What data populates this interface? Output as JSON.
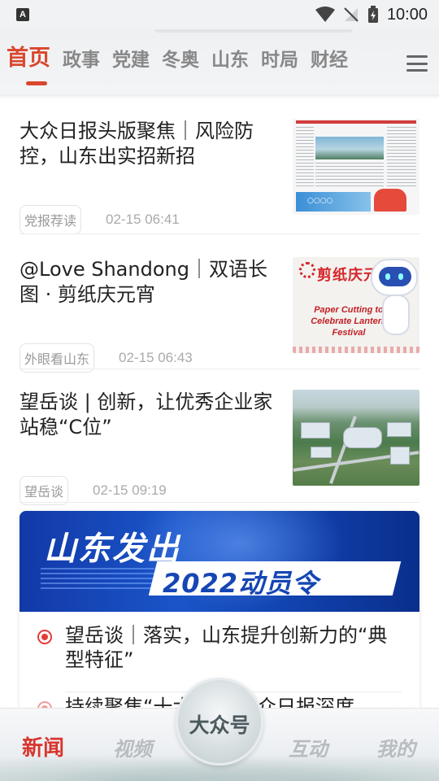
{
  "status_bar": {
    "time": "10:00",
    "left_icon": "A"
  },
  "top_tabs": [
    "首页",
    "政事",
    "党建",
    "冬奥",
    "山东",
    "时局",
    "财经"
  ],
  "articles": [
    {
      "title": "大众日报头版聚焦｜风险防控，山东出实招新招",
      "source": "党报荐读",
      "time": "02-15 06:41"
    },
    {
      "title": "@Love Shandong｜双语长图 · 剪纸庆元宵",
      "source": "外眼看山东",
      "time": "02-15 06:43"
    },
    {
      "title": "望岳谈 | 创新，让优秀企业家站稳“C位”",
      "source": "望岳谈",
      "time": "02-15 09:19"
    }
  ],
  "thumb2": {
    "title": "剪纸庆元宵",
    "english": "Paper Cutting to Celebrate Lantern Festival"
  },
  "banner": {
    "title": "山东发出",
    "subtitle": "2022动员令",
    "items": [
      "望岳谈｜落实，山东提升创新力的“典型特征”",
      "持续聚焦“十大…… 大众日报深度"
    ]
  },
  "bottom_nav": {
    "news": "新闻",
    "video": "视频",
    "center": "大众号",
    "interact": "互动",
    "mine": "我的"
  },
  "colors": {
    "accent": "#d9472e",
    "banner_blue": "#1a55c9"
  }
}
